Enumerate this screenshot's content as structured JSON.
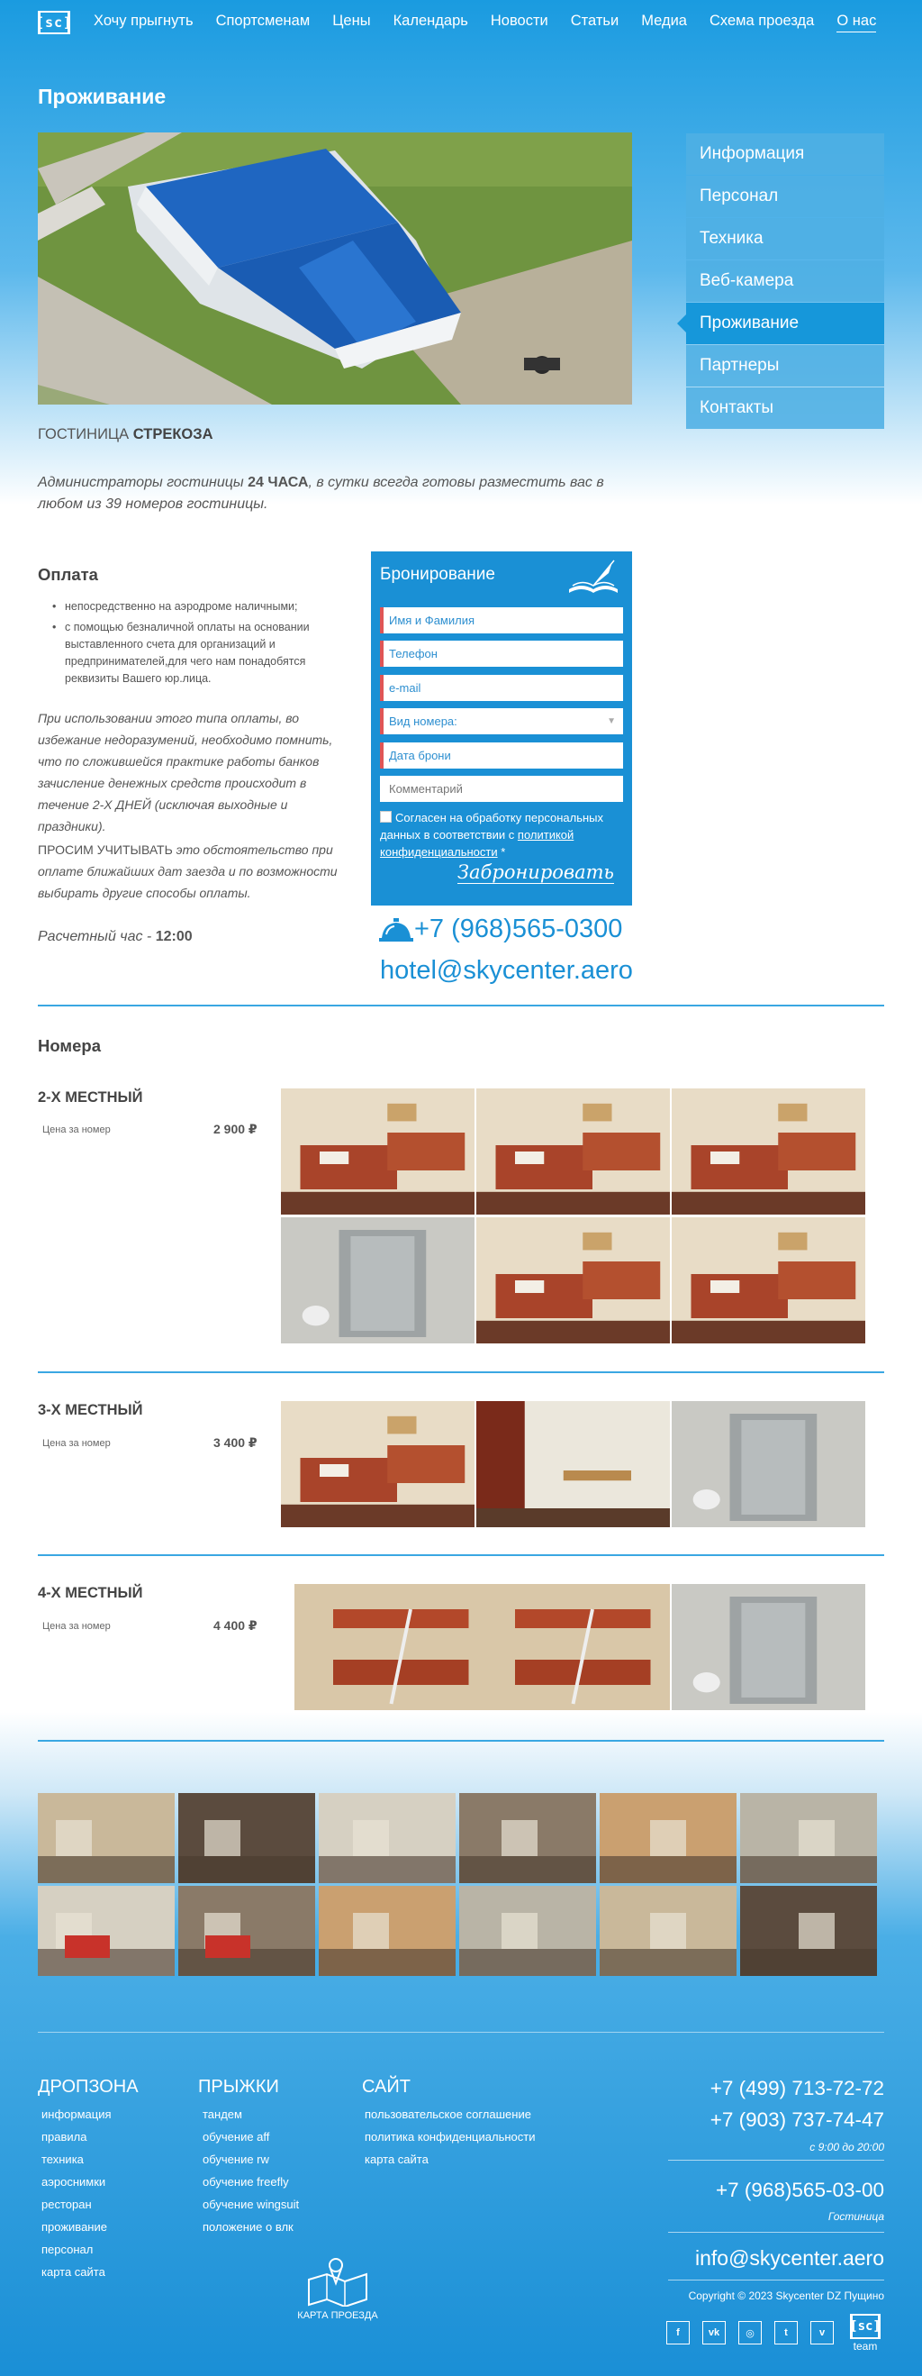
{
  "header": {
    "logo": "[sc]",
    "nav": [
      "Хочу прыгнуть",
      "Спортсменам",
      "Цены",
      "Календарь",
      "Новости",
      "Статьи",
      "Медиа",
      "Схема проезда",
      "О нас"
    ]
  },
  "page_title": "Проживание",
  "side_menu": [
    "Информация",
    "Персонал",
    "Техника",
    "Веб-камера",
    "Проживание",
    "Партнеры",
    "Контакты"
  ],
  "hotel": {
    "name_prefix": "ГОСТИНИЦА ",
    "name_bold": "СТРЕКОЗА",
    "intro_1": "Администраторы гостиницы ",
    "intro_bold": "24 ЧАСА",
    "intro_2": ", в сутки всегда готовы разместить вас в любом из 39 номеров гостиницы."
  },
  "payment": {
    "heading": "Оплата",
    "items": [
      "непосредственно на аэродроме наличными;",
      "с помощью безналичной оплаты на основании выставленного счета для организаций и предпринимателей,для чего нам понадобятся реквизиты Вашего юр.лица."
    ],
    "note": "При использовании этого типа оплаты, во избежание недоразумений, необходимо помнить, что по сложившейся практике работы банков зачисление денежных средств происходит в течение 2-Х ДНЕЙ (исключая выходные и праздники).",
    "warn_caps": "ПРОСИМ УЧИТЫВАТЬ",
    "warn_text": " это обстоятельство при оплате ближайших дат заезда и по возможности выбирать другие способы оплаты.",
    "checkout_label": "Расчетный час - ",
    "checkout_time": "12:00"
  },
  "booking": {
    "heading": "Бронирование",
    "fields": {
      "name": "Имя и Фамилия",
      "phone": "Телефон",
      "email": "e-mail",
      "room": "Вид номера:",
      "date": "Дата брони",
      "comment": "Комментарий"
    },
    "consent_1": "Согласен на обработку персональных данных в соответствии с ",
    "consent_link": "политикой конфиденциальности",
    "consent_star": " *",
    "submit": "Забронировать"
  },
  "contacts": {
    "phone": "+7 (968)565-0300",
    "email": "hotel@skycenter.aero"
  },
  "rooms_heading": "Номера",
  "rooms": [
    {
      "title": "2-Х МЕСТНЫЙ",
      "label": "Цена за номер",
      "price": "2 900 ₽"
    },
    {
      "title": "3-Х МЕСТНЫЙ",
      "label": "Цена за номер",
      "price": "3 400 ₽"
    },
    {
      "title": "4-Х МЕСТНЫЙ",
      "label": "Цена за номер",
      "price": "4 400 ₽"
    }
  ],
  "footer": {
    "col1": {
      "heading": "ДРОПЗОНА",
      "links": [
        "информация",
        "правила",
        "техника",
        "аэроснимки",
        "ресторан",
        "проживание",
        "персонал",
        "карта сайта"
      ]
    },
    "col2": {
      "heading": "ПРЫЖКИ",
      "links": [
        "тандем",
        "обучение aff",
        "обучение rw",
        "обучение freefly",
        "обучение wingsuit",
        "положение о влк"
      ]
    },
    "col3": {
      "heading": "САЙТ",
      "links": [
        "пользовательское соглашение",
        "политика конфиденциальности",
        "карта сайта"
      ]
    },
    "map_label": "КАРТА ПРОЕЗДА",
    "phone1": "+7 (499) 713-72-72",
    "phone2": "+7 (903) 737-74-47",
    "hours": "с 9:00 до 20:00",
    "phone3": "+7 (968)565-03-00",
    "phone3_label": "Гостиница",
    "email": "info@skycenter.aero",
    "copyright": "Copyright © 2023 Skycenter DZ Пущино",
    "socials": [
      "f",
      "vk",
      "◎",
      "t",
      "v"
    ],
    "team_logo": "[sc]",
    "team_text": "team"
  },
  "colors": {
    "brand_blue": "#1a90d5",
    "menu_blue": "#4eafe4",
    "required_red": "#e05555"
  }
}
